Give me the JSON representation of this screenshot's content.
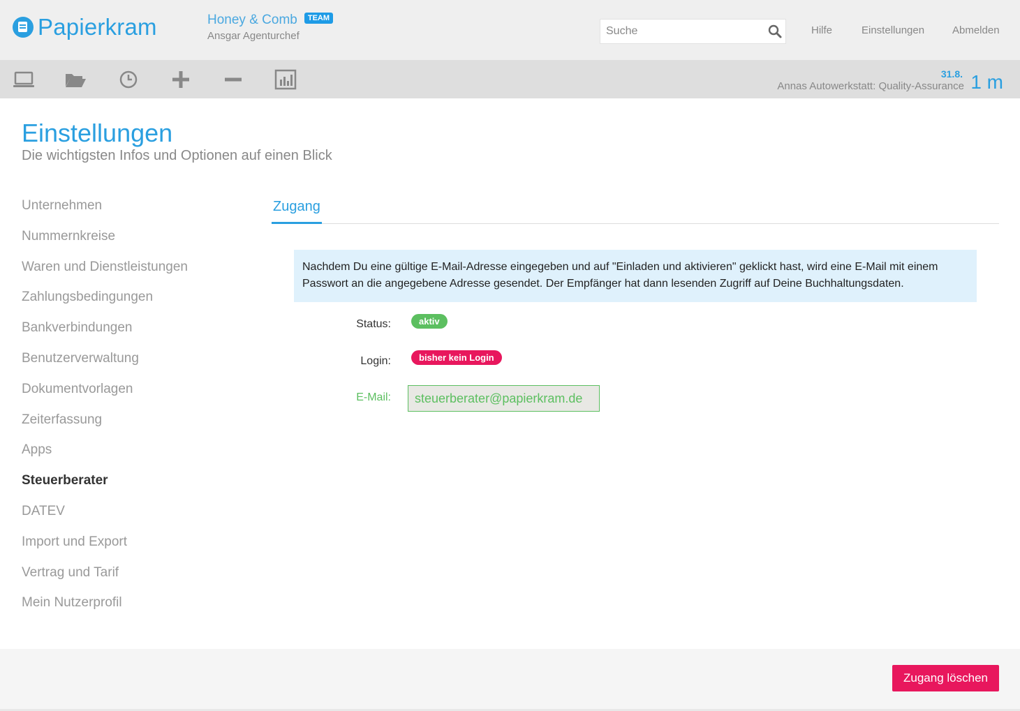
{
  "header": {
    "logo_text": "Papierkram",
    "company_name": "Honey & Comb",
    "team_badge": "TEAM",
    "user_name": "Ansgar Agenturchef",
    "search_placeholder": "Suche",
    "nav": {
      "help": "Hilfe",
      "settings": "Einstellungen",
      "logout": "Abmelden"
    }
  },
  "toolbar": {
    "icons": [
      "laptop-icon",
      "folder-open-icon",
      "clock-icon",
      "plus-icon",
      "minus-icon",
      "bar-chart-icon"
    ],
    "timer": {
      "date": "31.8.",
      "project": "Annas Autowerkstatt: Quality-Assurance",
      "value": "1 m"
    }
  },
  "page": {
    "title": "Einstellungen",
    "subtitle": "Die wichtigsten Infos und Optionen auf einen Blick"
  },
  "sidebar": {
    "items": [
      {
        "label": "Unternehmen"
      },
      {
        "label": "Nummernkreise"
      },
      {
        "label": "Waren und Dienstleistungen"
      },
      {
        "label": "Zahlungsbedingungen"
      },
      {
        "label": "Bankverbindungen"
      },
      {
        "label": "Benutzerverwaltung"
      },
      {
        "label": "Dokumentvorlagen"
      },
      {
        "label": "Zeiterfassung"
      },
      {
        "label": "Apps"
      },
      {
        "label": "Steuerberater"
      },
      {
        "label": "DATEV"
      },
      {
        "label": "Import und Export"
      },
      {
        "label": "Vertrag und Tarif"
      },
      {
        "label": "Mein Nutzerprofil"
      }
    ],
    "active": "Steuerberater"
  },
  "main": {
    "tab": "Zugang",
    "info_text": "Nachdem Du eine gültige E-Mail-Adresse eingegeben und auf \"Einladen und aktivieren\" geklickt hast, wird eine E-Mail mit einem Passwort an die angegebene Adresse gesendet. Der Empfänger hat dann lesenden Zugriff auf Deine Buchhaltungsdaten.",
    "status_label": "Status:",
    "status_value": "aktiv",
    "login_label": "Login:",
    "login_value": "bisher kein Login",
    "email_label": "E-Mail:",
    "email_value": "steuerberater@papierkram.de"
  },
  "footer": {
    "delete_button": "Zugang löschen"
  },
  "colors": {
    "accent": "#2a9fe0",
    "success": "#5cbf60",
    "danger": "#e8175d"
  }
}
